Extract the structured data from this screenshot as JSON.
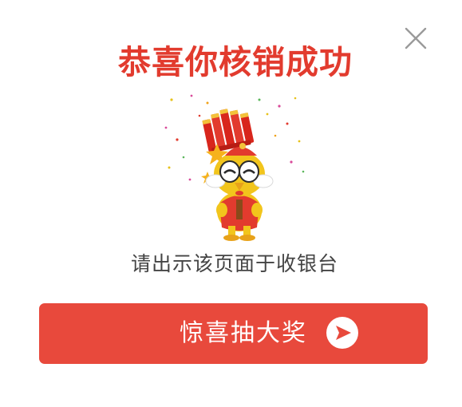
{
  "dialog": {
    "title": "恭喜你核销成功",
    "subtitle": "请出示该页面于收银台",
    "lottery_button_label": "惊喜抽大奖",
    "close_icon": "close-icon",
    "arrow_icon": "arrow-right-circle-icon",
    "mascot_icon": "rooster-mascot-with-firecrackers"
  },
  "colors": {
    "title": "#e23b2e",
    "button": "#e8493c",
    "subtitle": "#444444",
    "close": "#9a9a9a"
  }
}
